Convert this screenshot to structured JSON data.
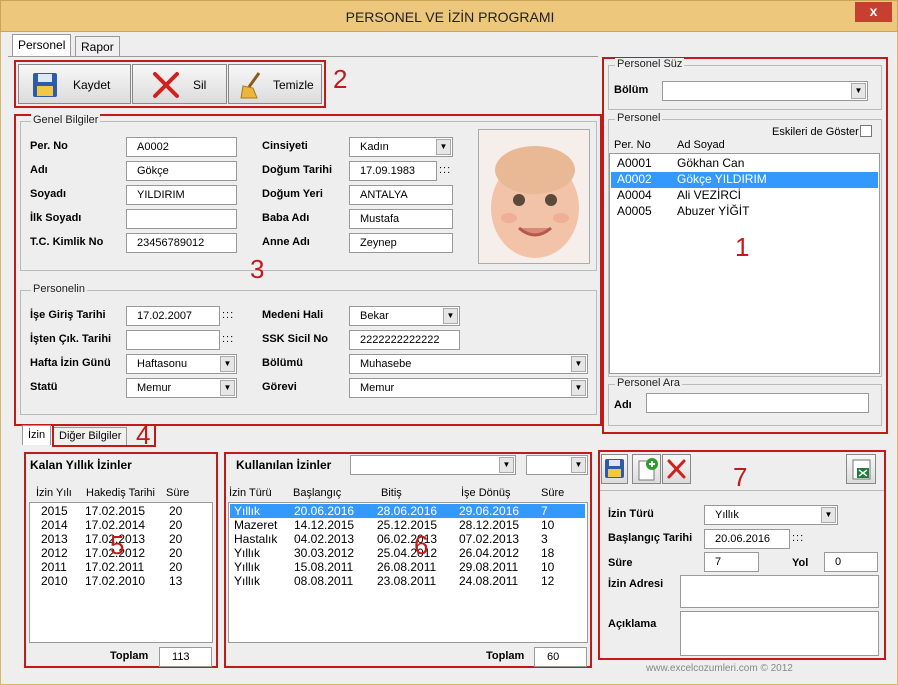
{
  "window": {
    "title": "PERSONEL VE İZİN PROGRAMI",
    "close": "x"
  },
  "main_tabs": [
    "Personel",
    "Rapor"
  ],
  "toolbar": {
    "save": "Kaydet",
    "delete": "Sil",
    "clear": "Temizle"
  },
  "markers": {
    "m1": "1",
    "m2": "2",
    "m3": "3",
    "m4": "4",
    "m5": "5",
    "m6": "6",
    "m7": "7"
  },
  "genel": {
    "title": "Genel Bilgiler",
    "per_no_label": "Per. No",
    "per_no": "A0002",
    "adi_label": "Adı",
    "adi": "Gökçe",
    "soyadi_label": "Soyadı",
    "soyadi": "YILDIRIM",
    "ilk_soyadi_label": "İlk Soyadı",
    "ilk_soyadi": "",
    "tc_label": "T.C. Kimlik No",
    "tc": "23456789012",
    "cinsiyet_label": "Cinsiyeti",
    "cinsiyet": "Kadın",
    "dogum_tarihi_label": "Doğum Tarihi",
    "dogum_tarihi": "17.09.1983",
    "dogum_yeri_label": "Doğum Yeri",
    "dogum_yeri": "ANTALYA",
    "baba_label": "Baba Adı",
    "baba": "Mustafa",
    "anne_label": "Anne Adı",
    "anne": "Zeynep"
  },
  "personelin": {
    "title": "Personelin",
    "giris_label": "İşe Giriş Tarihi",
    "giris": "17.02.2007",
    "cikis_label": "İşten Çık. Tarihi",
    "cikis": "",
    "hafta_label": "Hafta İzin Günü",
    "hafta": "Haftasonu",
    "statu_label": "Statü",
    "statu": "Memur",
    "medeni_label": "Medeni Hali",
    "medeni": "Bekar",
    "ssk_label": "SSK Sicil  No",
    "ssk": "2222222222222",
    "bolum_label": "Bölümü",
    "bolum": "Muhasebe",
    "gorev_label": "Görevi",
    "gorev": "Memur"
  },
  "dots": ":::",
  "suz": {
    "title": "Personel Süz",
    "bolum_label": "Bölüm",
    "bolum": ""
  },
  "personel_list": {
    "title": "Personel",
    "eskiler": "Eskileri de Göster",
    "col_no": "Per. No",
    "col_name": "Ad Soyad",
    "rows": [
      {
        "no": "A0001",
        "name": "Gökhan Can"
      },
      {
        "no": "A0002",
        "name": "Gökçe YILDIRIM"
      },
      {
        "no": "A0004",
        "name": "Ali VEZİRCİ"
      },
      {
        "no": "A0005",
        "name": "Abuzer YİĞİT"
      }
    ]
  },
  "ara": {
    "title": "Personel Ara",
    "adi_label": "Adı",
    "adi": ""
  },
  "lower_tabs": [
    "İzin",
    "Diğer Bilgiler"
  ],
  "kalan": {
    "title": "Kalan Yıllık İzinler",
    "cols": [
      "İzin Yılı",
      "Hakediş Tarihi",
      "Süre"
    ],
    "rows": [
      [
        "2015",
        "17.02.2015",
        "20"
      ],
      [
        "2014",
        "17.02.2014",
        "20"
      ],
      [
        "2013",
        "17.02.2013",
        "20"
      ],
      [
        "2012",
        "17.02.2012",
        "20"
      ],
      [
        "2011",
        "17.02.2011",
        "20"
      ],
      [
        "2010",
        "17.02.2010",
        "13"
      ]
    ],
    "toplam_label": "Toplam",
    "toplam": "113"
  },
  "kullanilan": {
    "title": "Kullanılan İzinler",
    "filter1": "",
    "filter2": "",
    "cols": [
      "İzin Türü",
      "Başlangıç",
      "Bitiş",
      "İşe Dönüş",
      "Süre"
    ],
    "rows": [
      [
        "Yıllık",
        "20.06.2016",
        "28.06.2016",
        "29.06.2016",
        "7"
      ],
      [
        "Mazeret",
        "14.12.2015",
        "25.12.2015",
        "28.12.2015",
        "10"
      ],
      [
        "Hastalık",
        "04.02.2013",
        "06.02.2013",
        "07.02.2013",
        "3"
      ],
      [
        "Yıllık",
        "30.03.2012",
        "25.04.2012",
        "26.04.2012",
        "18"
      ],
      [
        "Yıllık",
        "15.08.2011",
        "26.08.2011",
        "29.08.2011",
        "10"
      ],
      [
        "Yıllık",
        "08.08.2011",
        "23.08.2011",
        "24.08.2011",
        "12"
      ]
    ],
    "toplam_label": "Toplam",
    "toplam": "60"
  },
  "izin_form": {
    "tur_label": "İzin Türü",
    "tur": "Yıllık",
    "baslangic_label": "Başlangıç Tarihi",
    "baslangic": "20.06.2016",
    "sure_label": "Süre",
    "sure": "7",
    "yol_label": "Yol",
    "yol": "0",
    "adres_label": "İzin Adresi",
    "aciklama_label": "Açıklama"
  },
  "footer": "www.excelcozumleri.com © 2012"
}
